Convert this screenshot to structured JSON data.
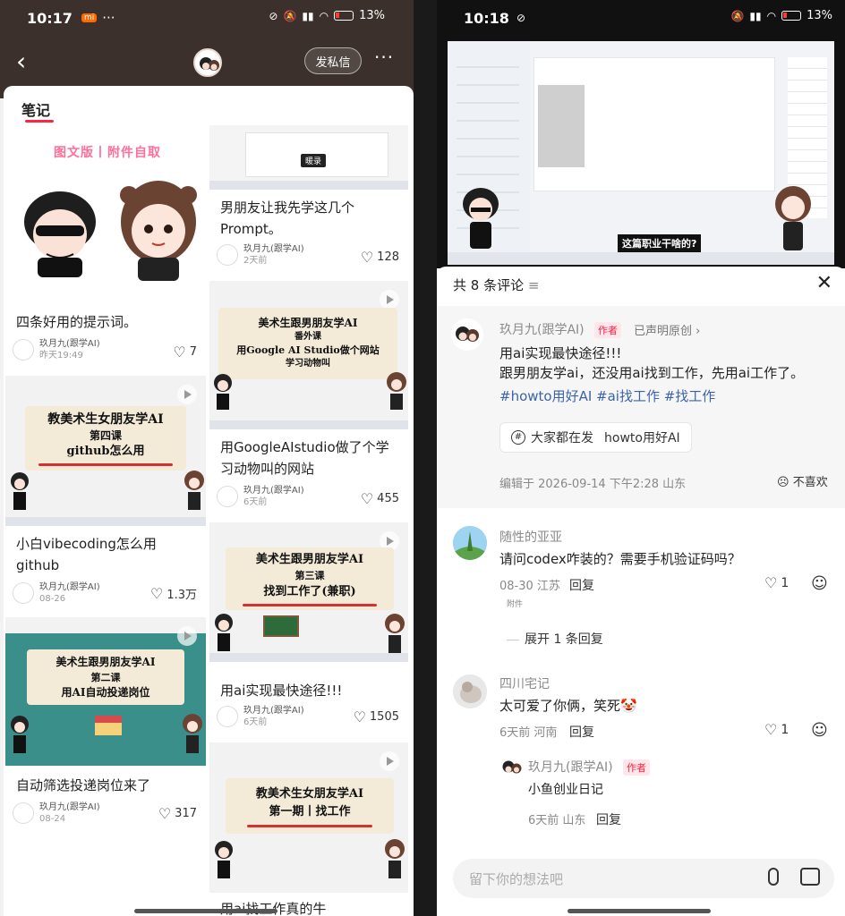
{
  "left": {
    "status": {
      "time": "10:17",
      "mi": "mi",
      "more": "···",
      "battery": "13%"
    },
    "nav": {
      "dm_label": "发私信",
      "more": "···"
    },
    "tab_label": "笔记",
    "cards": [
      {
        "title": "四条好用的提示词。",
        "author": "玖月九(跟学AI)",
        "date": "昨天19:49",
        "likes": "7",
        "cover_text": [
          "图文版丨附件自取"
        ]
      },
      {
        "title": "男朋友让我先学这几个Prompt。",
        "author": "玖月九(跟学AI)",
        "date": "2天前",
        "likes": "128",
        "cover_text": [
          "暖录"
        ]
      },
      {
        "title": "用GoogleAIstudio做了个学习动物叫的网站",
        "author": "玖月九(跟学AI)",
        "date": "6天前",
        "likes": "455",
        "cover_text": [
          "美术生跟男朋友学AI",
          "番外课",
          "用Google AI Studio做个网站",
          "学习动物叫"
        ]
      },
      {
        "title": "小白vibecoding怎么用github",
        "author": "玖月九(跟学AI)",
        "date": "08-26",
        "likes": "1.3万",
        "cover_text": [
          "教美术生女朋友学AI",
          "第四课",
          "github怎么用"
        ]
      },
      {
        "title": "用ai实现最快途径!!!",
        "author": "玖月九(跟学AI)",
        "date": "6天前",
        "likes": "1505",
        "cover_text": [
          "美术生跟男朋友学AI",
          "第三课",
          "找到工作了(兼职)"
        ]
      },
      {
        "title": "自动筛选投递岗位来了",
        "author": "玖月九(跟学AI)",
        "date": "08-24",
        "likes": "317",
        "cover_text": [
          "美术生跟男朋友学AI",
          "第二课",
          "用AI自动投递岗位"
        ]
      },
      {
        "title": "用ai找工作真的牛",
        "author": "",
        "date": "",
        "likes": "",
        "cover_text": [
          "教美术生女朋友学AI",
          "第一期丨找工作"
        ]
      }
    ]
  },
  "right": {
    "status": {
      "time": "10:18",
      "battery": "13%"
    },
    "video_caption": "这篇职业干啥的?",
    "comments_header": "共 8 条评论",
    "post": {
      "author": "玖月九(跟学AI)",
      "author_tag": "作者",
      "original": "已声明原创",
      "line1": "用ai实现最快途径!!!",
      "line2": "跟男朋友学ai，还没用ai找到工作，先用ai工作了。",
      "tags": "#howto用好AI #ai找工作 #找工作",
      "chip_label": "大家都在发",
      "chip_topic": "howto用好AI",
      "edited": "编辑于 2026-09-14 下午2:28 山东",
      "dislike": "不喜欢"
    },
    "comments": [
      {
        "user": "随性的亚亚",
        "text": "请问codex咋装的？需要手机验证码吗？",
        "date": "08-30",
        "loc": "江苏",
        "reply": "回复",
        "likes": "1",
        "note": "附件",
        "expand": "展开 1 条回复"
      },
      {
        "user": "四川宅记",
        "text": "太可爱了你俩，笑死🤡",
        "date": "6天前",
        "loc": "河南",
        "reply": "回复",
        "likes": "1",
        "sub": {
          "user": "玖月九(跟学AI)",
          "tag": "作者",
          "text": "小鱼创业日记",
          "date": "6天前",
          "loc": "山东",
          "reply": "回复"
        }
      }
    ],
    "input_placeholder": "留下你的想法吧"
  }
}
